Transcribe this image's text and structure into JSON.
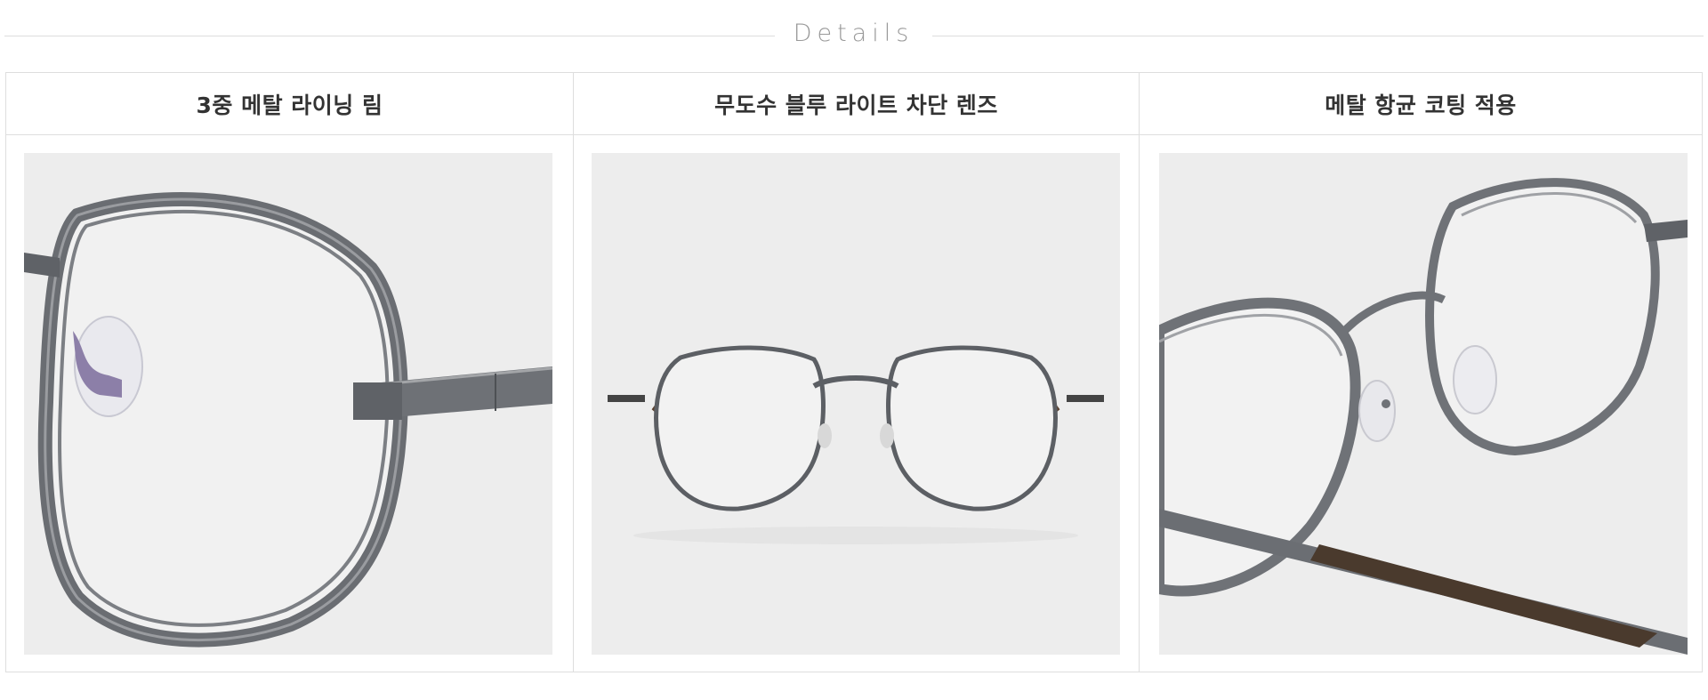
{
  "section": {
    "title": "Details"
  },
  "features": [
    {
      "title": "3중 메탈 라이닝 림",
      "image_icon": "eyeglass-rim-closeup"
    },
    {
      "title": "무도수 블루 라이트 차단 렌즈",
      "image_icon": "eyeglasses-front-view"
    },
    {
      "title": "메탈 항균 코팅 적용",
      "image_icon": "eyeglass-bridge-closeup"
    }
  ],
  "colors": {
    "background": "#ffffff",
    "divider": "#dedede",
    "header_text": "#999999",
    "title_text": "#333333",
    "photo_background": "#ededed",
    "frame_metal": "#6e7176"
  }
}
